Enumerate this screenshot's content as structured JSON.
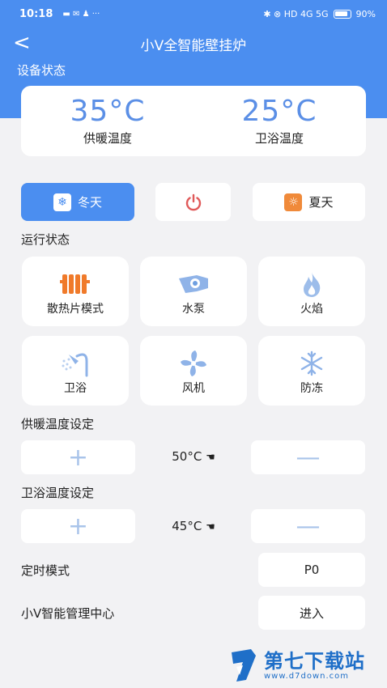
{
  "status_bar": {
    "time": "10:18",
    "notif_icons": "▬ ✉ ♟ ···",
    "right_icons": "✱ ⊗ HD 4G 5G",
    "battery": "90%"
  },
  "nav": {
    "back": "<",
    "title": "小V全智能壁挂炉"
  },
  "device_status": {
    "label": "设备状态",
    "heating_temp": "35°C",
    "heating_label": "供暖温度",
    "bath_temp": "25°C",
    "bath_label": "卫浴温度"
  },
  "season": {
    "winter": "冬天",
    "summer": "夏天",
    "power_icon": "power-icon"
  },
  "run_status": {
    "label": "运行状态",
    "tiles": [
      {
        "label": "散热片模式",
        "icon": "radiator-icon"
      },
      {
        "label": "水泵",
        "icon": "pump-icon"
      },
      {
        "label": "火焰",
        "icon": "flame-icon"
      },
      {
        "label": "卫浴",
        "icon": "shower-icon"
      },
      {
        "label": "风机",
        "icon": "fan-icon"
      },
      {
        "label": "防冻",
        "icon": "snowflake-icon"
      }
    ]
  },
  "heating_set": {
    "label": "供暖温度设定",
    "value": "50°C",
    "plus": "+",
    "minus": "—"
  },
  "bath_set": {
    "label": "卫浴温度设定",
    "value": "45°C",
    "plus": "+",
    "minus": "—"
  },
  "timer": {
    "label": "定时模式",
    "value": "P0"
  },
  "center": {
    "label": "小V智能管理中心",
    "button": "进入"
  },
  "watermark": {
    "text": "第七下载站",
    "sub": "www.d7down.com"
  },
  "colors": {
    "primary": "#4b8ef0",
    "accent_orange": "#f07a2a",
    "power_red": "#e05a5a",
    "icon_blue": "#6f9fe0"
  }
}
